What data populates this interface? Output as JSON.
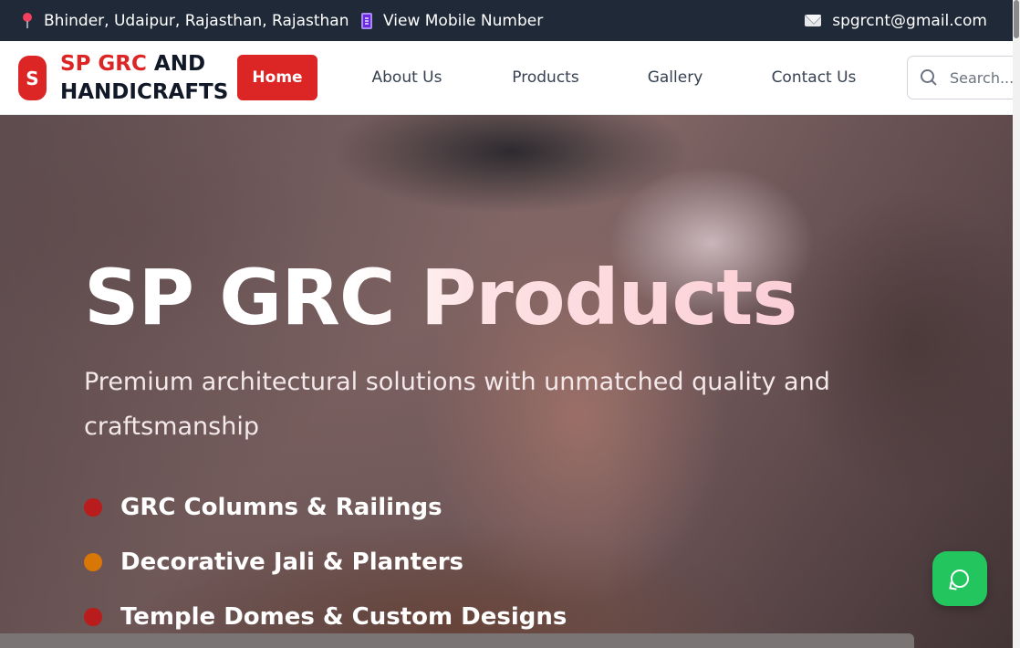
{
  "topbar": {
    "location": "Bhinder, Udaipur, Rajasthan, Rajasthan",
    "phone_link": "View Mobile Number",
    "email": "spgrcnt@gmail.com"
  },
  "header": {
    "logo_letter": "S",
    "brand_accent": "SP GRC",
    "brand_rest": " AND",
    "brand_line2": "HANDICRAFTS",
    "nav": {
      "home": "Home",
      "about": "About Us",
      "products": "Products",
      "gallery": "Gallery",
      "contact": "Contact Us"
    },
    "search_placeholder": "Search..."
  },
  "hero": {
    "title": "SP GRC Products",
    "subtitle": "Premium architectural solutions with unmatched quality and craftsmanship",
    "features": [
      {
        "label": "GRC Columns & Railings",
        "color": "#b91c1c"
      },
      {
        "label": "Decorative Jali & Planters",
        "color": "#d97706"
      },
      {
        "label": "Temple Domes & Custom Designs",
        "color": "#b91c1c"
      }
    ]
  },
  "colors": {
    "brand_red": "#dc2626",
    "topbar_bg": "#1f2937",
    "chat_green": "#22c55e"
  },
  "icons": [
    "pin-icon",
    "phone-icon",
    "mail-icon",
    "search-icon",
    "chat-icon"
  ]
}
